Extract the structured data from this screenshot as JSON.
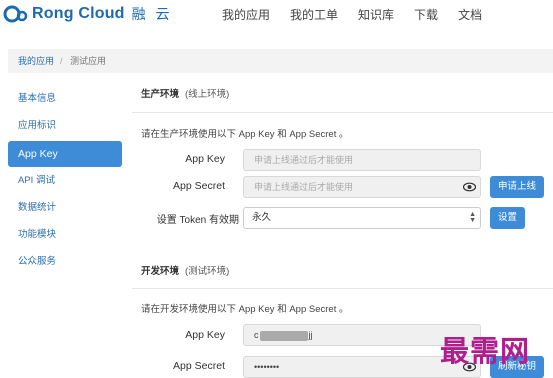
{
  "brand": {
    "name": "Rong Cloud",
    "cn": "融 云",
    "color": "#1b6bb0"
  },
  "nav": [
    "我的应用",
    "我的工单",
    "知识库",
    "下载",
    "文档"
  ],
  "breadcrumb": {
    "home": "我的应用",
    "sep": "/",
    "current": "测试应用"
  },
  "sidebar": {
    "items": [
      {
        "label": "基本信息"
      },
      {
        "label": "应用标识"
      },
      {
        "label": "App Key",
        "active": true
      },
      {
        "label": "API 调试"
      },
      {
        "label": "数据统计"
      },
      {
        "label": "功能模块"
      },
      {
        "label": "公众服务"
      }
    ]
  },
  "production": {
    "title": "生产环境",
    "subtitle": "(线上环境)",
    "desc": "请在生产环境使用以下 App Key 和 App Secret 。",
    "app_key_label": "App Key",
    "app_key_placeholder": "申请上线通过后才能使用",
    "app_secret_label": "App Secret",
    "app_secret_placeholder": "申请上线通过后才能使用",
    "apply_button": "申请上线",
    "token_label": "设置 Token 有效期",
    "token_value": "永久",
    "set_button": "设置"
  },
  "development": {
    "title": "开发环境",
    "subtitle": "(测试环境)",
    "desc": "请在开发环境使用以下 App Key 和 App Secret 。",
    "app_key_label": "App Key",
    "app_key_prefix": "c",
    "app_key_suffix": "jj",
    "app_secret_label": "App Secret",
    "app_secret_value": "••••••••",
    "refresh_button": "刷新秘钥"
  },
  "watermark": "最需网",
  "colors": {
    "accent": "#3e8bd8",
    "link": "#2a6fb0"
  }
}
